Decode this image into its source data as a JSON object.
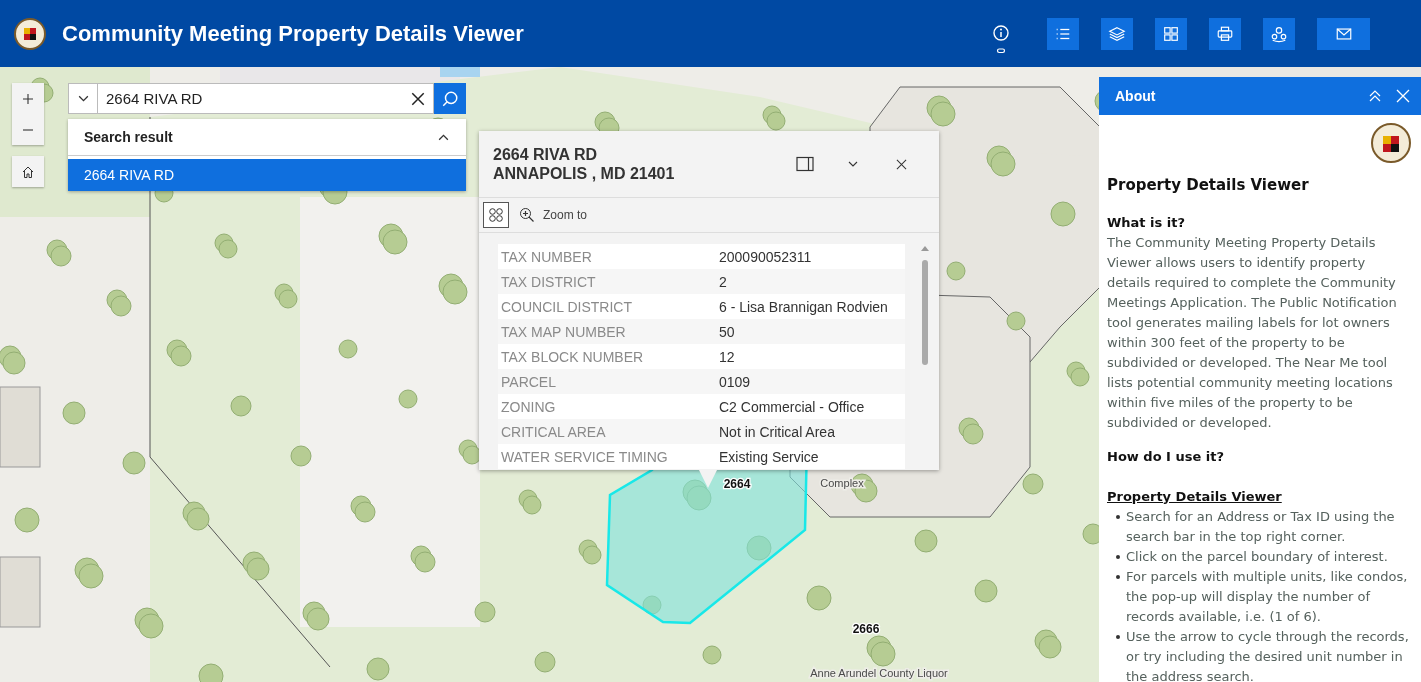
{
  "header": {
    "title": "Community Meeting Property Details Viewer"
  },
  "search": {
    "value": "2664 RIVA RD",
    "results_heading": "Search result",
    "results_expanded": true,
    "results": [
      {
        "label": "2664 RIVA RD",
        "selected": true
      }
    ]
  },
  "popup": {
    "title_lines": [
      "2664 RIVA RD",
      "ANNAPOLIS , MD 21401"
    ],
    "action": "Zoom to",
    "fields": [
      {
        "label": "TAX NUMBER",
        "value": "200090052311"
      },
      {
        "label": "TAX DISTRICT",
        "value": "2"
      },
      {
        "label": "COUNCIL DISTRICT",
        "value": "6 - Lisa Brannigan Rodvien"
      },
      {
        "label": "TAX MAP NUMBER",
        "value": "50"
      },
      {
        "label": "TAX BLOCK NUMBER",
        "value": "12"
      },
      {
        "label": "PARCEL",
        "value": "0109"
      },
      {
        "label": "ZONING",
        "value": "C2 Commercial - Office"
      },
      {
        "label": "CRITICAL AREA",
        "value": "Not in Critical Area"
      },
      {
        "label": "WATER SERVICE TIMING",
        "value": "Existing Service"
      }
    ]
  },
  "map_labels": [
    "2664",
    "Complex",
    "2666",
    "Anne Arundel County Liquor"
  ],
  "about": {
    "title": "About",
    "heading": "Property Details Viewer",
    "blocks": [
      {
        "kind": "subheading",
        "text": "What is it?"
      },
      {
        "kind": "paragraph",
        "text": "The Community Meeting Property Details Viewer allows users to identify property details required to complete the Community Meetings Application. The Public Notification tool generates mailing labels for lot owners within 300 feet of the property to be subdivided or developed. The Near Me tool lists potential community meeting locations within five miles of the property to be subdivided or developed."
      },
      {
        "kind": "subheading",
        "text": "How do I use it?"
      },
      {
        "kind": "underlined",
        "text": "Property Details Viewer"
      },
      {
        "kind": "bullets",
        "items": [
          "Search for an Address or Tax ID using the search bar in the top right corner.",
          "Click on the parcel boundary of interest.",
          "For parcels with multiple units, like condos, the pop-up will display the number of records available, i.e. (1 of 6).",
          "Use the arrow to cycle through the records, or try including the desired unit number in the address search."
        ]
      }
    ]
  }
}
